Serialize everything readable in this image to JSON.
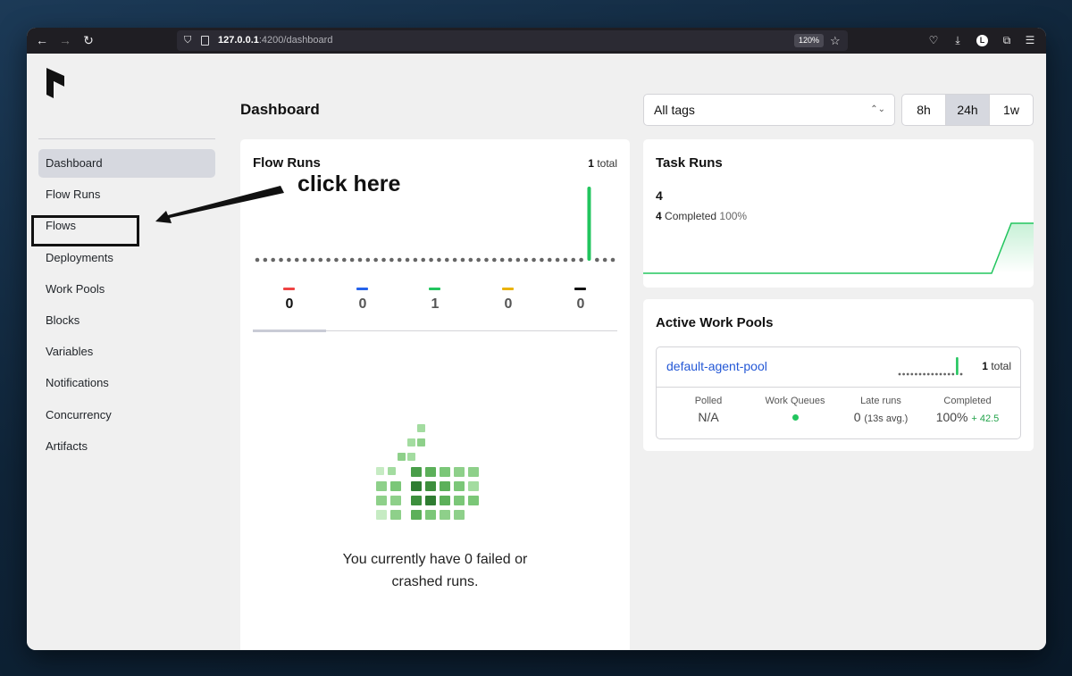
{
  "browser": {
    "url_host": "127.0.0.1",
    "url_path": ":4200/dashboard",
    "zoom": "120%",
    "profile_initial": "L"
  },
  "sidebar": {
    "items": [
      {
        "label": "Dashboard",
        "active": true
      },
      {
        "label": "Flow Runs"
      },
      {
        "label": "Flows"
      },
      {
        "label": "Deployments"
      },
      {
        "label": "Work Pools"
      },
      {
        "label": "Blocks"
      },
      {
        "label": "Variables"
      },
      {
        "label": "Notifications"
      },
      {
        "label": "Concurrency"
      },
      {
        "label": "Artifacts"
      }
    ]
  },
  "header": {
    "title": "Dashboard",
    "tags_value": "All tags",
    "ranges": [
      "8h",
      "24h",
      "1w"
    ],
    "active_range": "24h"
  },
  "flow_runs": {
    "title": "Flow Runs",
    "total_count": "1",
    "total_label": "total",
    "states": [
      {
        "count": "0",
        "color": "#ef4444",
        "active": true
      },
      {
        "count": "0",
        "color": "#2563eb"
      },
      {
        "count": "1",
        "color": "#22c55e"
      },
      {
        "count": "0",
        "color": "#eab308"
      },
      {
        "count": "0",
        "color": "#111111"
      }
    ],
    "empty_line1": "You currently have 0 failed or",
    "empty_line2": "crashed runs."
  },
  "task_runs": {
    "title": "Task Runs",
    "count": "4",
    "completed_count": "4",
    "completed_label": "Completed",
    "completed_pct": "100%"
  },
  "work_pools": {
    "title": "Active Work Pools",
    "pool_name": "default-agent-pool",
    "total_count": "1",
    "total_label": "total",
    "stats": {
      "polled_label": "Polled",
      "polled_value": "N/A",
      "queues_label": "Work Queues",
      "late_label": "Late runs",
      "late_value": "0",
      "late_avg": "(13s avg.)",
      "completed_label": "Completed",
      "completed_value": "100%",
      "completed_delta": "+ 42.5"
    }
  },
  "annotation": {
    "text": "click here"
  },
  "colors": {
    "accent_green": "#22c55e",
    "link_blue": "#2458d6",
    "active_bg": "#d6d8df"
  }
}
